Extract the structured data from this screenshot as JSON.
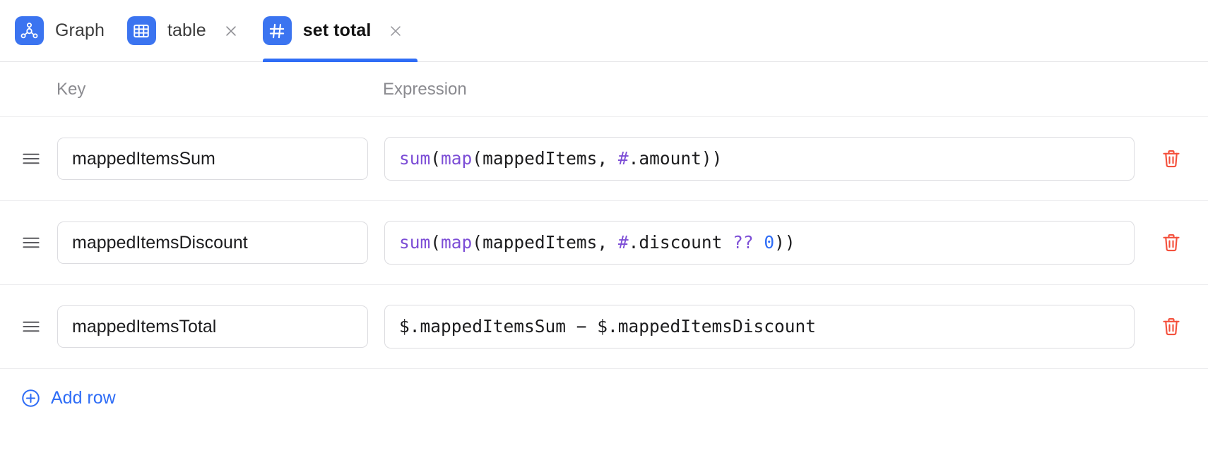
{
  "tabs": [
    {
      "label": "Graph",
      "icon": "graph-nodes-icon",
      "closable": false,
      "active": false
    },
    {
      "label": "table",
      "icon": "table-grid-icon",
      "closable": true,
      "active": false
    },
    {
      "label": "set total",
      "icon": "hash-icon",
      "closable": true,
      "active": true
    }
  ],
  "columns": {
    "key_label": "Key",
    "expression_label": "Expression"
  },
  "rows": [
    {
      "key": "mappedItemsSum",
      "expression": "sum(map(mappedItems, #.amount))",
      "tokens": [
        {
          "t": "sum",
          "c": "fn"
        },
        {
          "t": "(",
          "c": "punct"
        },
        {
          "t": "map",
          "c": "fn"
        },
        {
          "t": "(",
          "c": "punct"
        },
        {
          "t": "mappedItems",
          "c": "ident"
        },
        {
          "t": ", ",
          "c": "punct"
        },
        {
          "t": "#",
          "c": "hash"
        },
        {
          "t": ".amount",
          "c": "ident"
        },
        {
          "t": "))",
          "c": "punct"
        }
      ]
    },
    {
      "key": "mappedItemsDiscount",
      "expression": "sum(map(mappedItems, #.discount ?? 0))",
      "tokens": [
        {
          "t": "sum",
          "c": "fn"
        },
        {
          "t": "(",
          "c": "punct"
        },
        {
          "t": "map",
          "c": "fn"
        },
        {
          "t": "(",
          "c": "punct"
        },
        {
          "t": "mappedItems",
          "c": "ident"
        },
        {
          "t": ", ",
          "c": "punct"
        },
        {
          "t": "#",
          "c": "hash"
        },
        {
          "t": ".discount ",
          "c": "ident"
        },
        {
          "t": "??",
          "c": "op"
        },
        {
          "t": " ",
          "c": "punct"
        },
        {
          "t": "0",
          "c": "num"
        },
        {
          "t": "))",
          "c": "punct"
        }
      ]
    },
    {
      "key": "mappedItemsTotal",
      "expression": "$.mappedItemsSum − $.mappedItemsDiscount",
      "tokens": [
        {
          "t": "$.mappedItemsSum − $.mappedItemsDiscount",
          "c": "plain"
        }
      ]
    }
  ],
  "add_row": {
    "label": "Add row",
    "icon": "plus-circle-icon"
  },
  "colors": {
    "accent_blue": "#2f6df6",
    "icon_blue": "#3b74f0",
    "delete_red": "#f4503c",
    "keyword_purple": "#7c4dd6",
    "number_blue": "#2f6df6",
    "muted_text": "#8b8b90",
    "border": "#dcdce0"
  }
}
